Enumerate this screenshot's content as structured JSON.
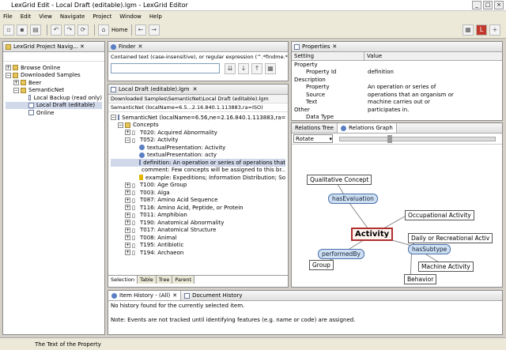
{
  "window": {
    "title": "LexGrid Edit - Local Draft (editable).lgm - LexGrid Editor"
  },
  "menu": [
    "File",
    "Edit",
    "View",
    "Navigate",
    "Project",
    "Window",
    "Help"
  ],
  "toolbar": {
    "home_label": "Home"
  },
  "navigator": {
    "title": "LexGrid Project Navig...",
    "items": [
      "Browse Online",
      "Downloaded Samples",
      "Beer",
      "SemanticNet",
      "Local Backup (read only)",
      "Local Draft (editable)",
      "Online"
    ]
  },
  "finder": {
    "title": "Finder",
    "hint": "Contained text (case-insensitive), or regular expression (^.*findme.*)"
  },
  "editor": {
    "tab": "Local Draft (editable).lgm",
    "path": "Downloaded Samples\\SemanticNet\\Local Draft (editable).lgm",
    "scheme": "SemanticNet (localName=6.56,ne=2.16.840.1.113883,ra=ISO)",
    "header": "SemanticNet (localName=6.5...2.16.840.1.113883,ra=ISO)",
    "concepts_label": "Concepts",
    "rows": [
      "T020: Acquired Abnormality",
      "T052: Activity",
      "textualPresentation: Activity",
      "textualPresentation: acty",
      "definition: An operation or series of operations that",
      "comment: Few concepts will be assigned to this br...",
      "example: Expeditions; Information Distribution; So",
      "T100: Age Group",
      "T003: Alga",
      "T087: Amino Acid Sequence",
      "T116: Amino Acid, Peptide, or Protein",
      "T011: Amphibian",
      "T190: Anatomical Abnormality",
      "T017: Anatomical Structure",
      "T008: Animal",
      "T195: Antibiotic",
      "T194: Archaeon"
    ],
    "bottom_tabs": [
      "Selection",
      "Table",
      "Tree",
      "Parent"
    ]
  },
  "properties": {
    "title": "Properties",
    "col_setting": "Setting",
    "col_value": "Value",
    "rows": [
      {
        "k": "Property",
        "v": ""
      },
      {
        "k": "Property Id",
        "v": "definition"
      },
      {
        "k": "Description",
        "v": ""
      },
      {
        "k": "Property",
        "v": "An operation or series of"
      },
      {
        "k": "Source",
        "v": "operations that an organism or"
      },
      {
        "k": "Text",
        "v": "machine carries out or"
      },
      {
        "k": "Other",
        "v": "participates in."
      },
      {
        "k": "Data Type",
        "v": ""
      }
    ]
  },
  "relations": {
    "tab1": "Relations Tree",
    "tab2": "Relations Graph",
    "mode": "Rotate",
    "center": "Activity",
    "nodes": [
      "Qualitative Concept",
      "hasEvaluation",
      "Occupational Activity",
      "Daily or Recreational Activ",
      "hasSubtype",
      "performedBy",
      "Group",
      "Machine Activity",
      "Behavior"
    ]
  },
  "history": {
    "tab1": "Item History - (All)",
    "tab2": "Document History",
    "line1": "No history found for the currently selected item.",
    "line2": "Note: Events are not tracked until identifying features (e.g. name or code) are assigned."
  },
  "status": "The Text of the Property"
}
